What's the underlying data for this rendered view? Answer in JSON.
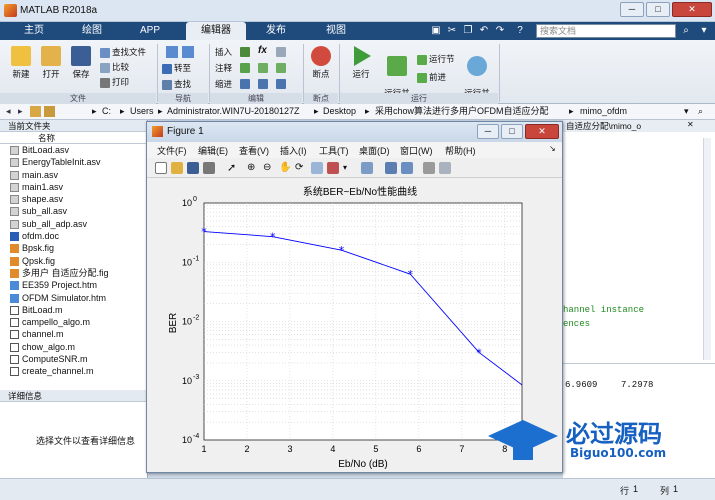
{
  "app": {
    "title": "MATLAB R2018a",
    "win_min": "─",
    "win_max": "□",
    "win_close": "✕"
  },
  "tabs": [
    "主页",
    "绘图",
    "APP",
    "编辑器",
    "发布",
    "视图"
  ],
  "search_placeholder": "搜索文档",
  "ribbon": {
    "file": {
      "new": "新建",
      "open": "打开",
      "save": "保存",
      "find_files": "查找文件",
      "compare": "比较",
      "print": "打印",
      "group": "文件"
    },
    "nav": {
      "goto": "转至",
      "find": "查找",
      "group": "导航"
    },
    "edit": {
      "insert": "插入",
      "comment": "注释",
      "indent": "缩进",
      "fx": "fx",
      "group": "编辑"
    },
    "breakpoints": {
      "label": "断点",
      "group": "断点"
    },
    "run": {
      "run": "运行",
      "run_advance": "运行并\n前进",
      "run_section": "运行节",
      "advance": "前进",
      "run_time": "运行并\n计时",
      "group": "运行"
    }
  },
  "address": [
    "C:",
    "Users",
    "Administrator.WIN7U-20180127Z",
    "Desktop",
    "采用chow算法进行多用户OFDM自适应分配",
    "mimo_ofdm"
  ],
  "left_panel": {
    "header": "当前文件夹",
    "col_name": "名称",
    "files": [
      {
        "name": "BitLoad.asv",
        "type": "asv"
      },
      {
        "name": "EnergyTableInit.asv",
        "type": "asv"
      },
      {
        "name": "main.asv",
        "type": "asv"
      },
      {
        "name": "main1.asv",
        "type": "asv"
      },
      {
        "name": "shape.asv",
        "type": "asv"
      },
      {
        "name": "sub_all.asv",
        "type": "asv"
      },
      {
        "name": "sub_all_adp.asv",
        "type": "asv"
      },
      {
        "name": "ofdm.doc",
        "type": "doc"
      },
      {
        "name": "Bpsk.fig",
        "type": "fig"
      },
      {
        "name": "Qpsk.fig",
        "type": "fig"
      },
      {
        "name": "多用户 自适应分配.fig",
        "type": "fig"
      },
      {
        "name": "EE359 Project.htm",
        "type": "htm"
      },
      {
        "name": "OFDM Simulator.htm",
        "type": "htm"
      },
      {
        "name": "BitLoad.m",
        "type": "m"
      },
      {
        "name": "campello_algo.m",
        "type": "m"
      },
      {
        "name": "channel.m",
        "type": "m"
      },
      {
        "name": "chow_algo.m",
        "type": "m"
      },
      {
        "name": "ComputeSNR.m",
        "type": "m"
      },
      {
        "name": "create_channel.m",
        "type": "m"
      }
    ],
    "details_header": "详细信息",
    "details_text": "选择文件以查看详细信息"
  },
  "editor_tab": "自适应分配\\mimo_o",
  "code_lines": [
    "hannel instance",
    "ences"
  ],
  "cmd_values": [
    "6.9609",
    "7.2978"
  ],
  "status": {
    "row_label": "行",
    "row": "1",
    "col_label": "列",
    "col": "1"
  },
  "figure": {
    "title": "Figure 1",
    "menu": [
      "文件(F)",
      "编辑(E)",
      "查看(V)",
      "插入(I)",
      "工具(T)",
      "桌面(D)",
      "窗口(W)",
      "帮助(H)"
    ]
  },
  "chart_data": {
    "type": "line",
    "title": "系统BER~Eb/No性能曲线",
    "xlabel": "Eb/No (dB)",
    "ylabel": "BER",
    "xlim": [
      1,
      8.4
    ],
    "ylim_exp": [
      -4,
      0
    ],
    "yscale": "log",
    "grid": true,
    "x_ticks": [
      "1",
      "2",
      "3",
      "4",
      "5",
      "6",
      "7",
      "8"
    ],
    "y_tick_exps": [
      "0",
      "-1",
      "-2",
      "-3",
      "-4"
    ],
    "series": [
      {
        "color": "#0000ff",
        "marker": "*",
        "x": [
          1,
          2.6,
          4.2,
          5.8,
          7.4,
          9.0
        ],
        "y": [
          0.33,
          0.27,
          0.16,
          0.063,
          0.003,
          0.0004
        ]
      }
    ]
  },
  "watermark": {
    "title": "必过源码",
    "url": "Biguo100.com"
  }
}
